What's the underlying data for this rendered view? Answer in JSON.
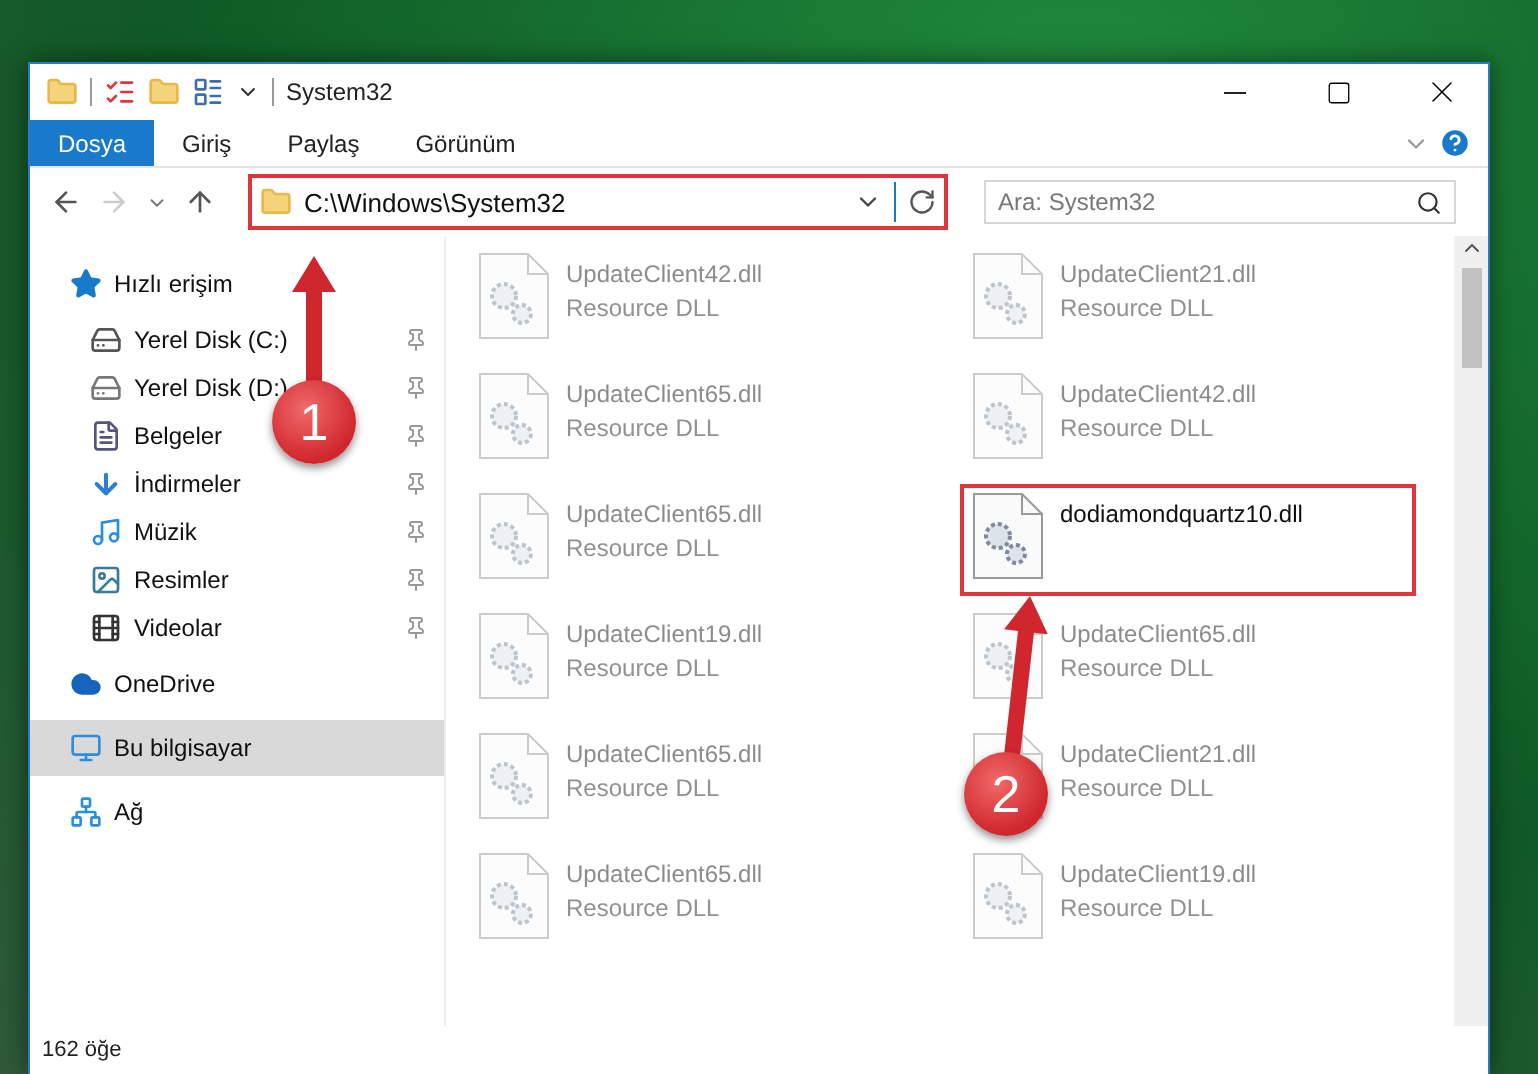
{
  "window": {
    "title": "System32"
  },
  "ribbon_tabs": [
    {
      "label": "Dosya",
      "selected": true
    },
    {
      "label": "Giriş",
      "selected": false
    },
    {
      "label": "Paylaş",
      "selected": false
    },
    {
      "label": "Görünüm",
      "selected": false
    }
  ],
  "address": {
    "path": "C:\\Windows\\System32",
    "highlighted": true
  },
  "search": {
    "placeholder": "Ara: System32"
  },
  "sidebar": {
    "items": [
      {
        "label": "Hızlı erişim",
        "kind": "star",
        "selected": false,
        "children": [
          {
            "label": "Yerel Disk (C:)",
            "kind": "system-drive",
            "pinned": true,
            "selected": false
          },
          {
            "label": "Yerel Disk (D:)",
            "kind": "drive",
            "pinned": true,
            "selected": false
          },
          {
            "label": "Belgeler",
            "kind": "documents",
            "pinned": true,
            "selected": false
          },
          {
            "label": "İndirmeler",
            "kind": "downloads",
            "pinned": true,
            "selected": false
          },
          {
            "label": "Müzik",
            "kind": "music",
            "pinned": true,
            "selected": false
          },
          {
            "label": "Resimler",
            "kind": "pictures",
            "pinned": true,
            "selected": false
          },
          {
            "label": "Videolar",
            "kind": "videos",
            "pinned": true,
            "selected": false
          }
        ]
      },
      {
        "label": "OneDrive",
        "kind": "cloud",
        "selected": false
      },
      {
        "label": "Bu bilgisayar",
        "kind": "computer",
        "selected": true
      },
      {
        "label": "Ağ",
        "kind": "network",
        "selected": false
      }
    ]
  },
  "files": [
    {
      "name": "UpdateClient42.dll",
      "type": "Resource DLL",
      "blurred": true,
      "highlighted": false
    },
    {
      "name": "UpdateClient21.dll",
      "type": "Resource DLL",
      "blurred": true,
      "highlighted": false
    },
    {
      "name": "UpdateClient65.dll",
      "type": "Resource DLL",
      "blurred": true,
      "highlighted": false
    },
    {
      "name": "UpdateClient42.dll",
      "type": "Resource DLL",
      "blurred": true,
      "highlighted": false
    },
    {
      "name": "UpdateClient65.dll",
      "type": "Resource DLL",
      "blurred": true,
      "highlighted": false
    },
    {
      "name": "dodiamondquartz10.dll",
      "blurred": false,
      "highlighted": true
    },
    {
      "name": "UpdateClient19.dll",
      "type": "Resource DLL",
      "blurred": true,
      "highlighted": false
    },
    {
      "name": "UpdateClient65.dll",
      "type": "Resource DLL",
      "blurred": true,
      "highlighted": false
    },
    {
      "name": "UpdateClient65.dll",
      "type": "Resource DLL",
      "blurred": true,
      "highlighted": false
    },
    {
      "name": "UpdateClient21.dll",
      "type": "Resource DLL",
      "blurred": true,
      "highlighted": false
    },
    {
      "name": "UpdateClient65.dll",
      "type": "Resource DLL",
      "blurred": true,
      "highlighted": false
    },
    {
      "name": "UpdateClient19.dll",
      "type": "Resource DLL",
      "blurred": true,
      "highlighted": false
    }
  ],
  "status_bar": {
    "count": "162 öğe"
  },
  "annotations": [
    {
      "label": "1"
    },
    {
      "label": "2"
    }
  ]
}
